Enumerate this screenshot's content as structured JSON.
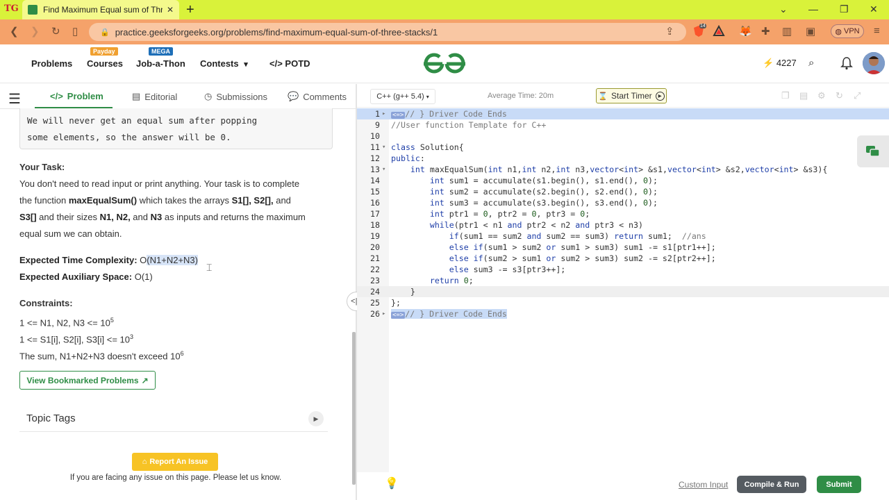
{
  "browser": {
    "tab_title": "Find Maximum Equal sum of Thre",
    "tab_close": "✕",
    "new_tab": "+",
    "url": "practice.geeksforgeeks.org/problems/find-maximum-equal-sum-of-three-stacks/1",
    "vpn_label": "VPN",
    "ext_badge": "14"
  },
  "header": {
    "nav": [
      "Problems",
      "Courses",
      "Job-a-Thon",
      "Contests",
      "POTD"
    ],
    "courses_badge": "Payday",
    "jobathon_badge": "MEGA",
    "streak": "4227",
    "colors": {
      "brand_green": "#2f8d46",
      "badge_orange": "#f0a030",
      "badge_blue": "#1e6fb8"
    }
  },
  "left_tabs": {
    "problem": "Problem",
    "editorial": "Editorial",
    "submissions": "Submissions",
    "comments": "Comments"
  },
  "problem": {
    "example_line1": "We will never get an equal sum after popping",
    "example_line2": "some elements, so the answer will be 0.",
    "task_heading": "Your Task:",
    "task_p1": "You don't need to read input or print anything. Your task is to complete",
    "task_p2_a": "the function ",
    "task_fn": "maxEqualSum()",
    "task_p2_b": " which takes the arrays ",
    "task_arr1": "S1[], S2[],",
    "task_p2_c": " and",
    "task_arr3": "S3[]",
    "task_p3_a": " and their sizes ",
    "task_sizes": "N1, N2,",
    "task_p3_b": " and ",
    "task_n3": "N3",
    "task_p3_c": " as inputs and returns the maximum",
    "task_p4": "equal sum we can obtain.",
    "etc_label": "Expected Time Complexity:",
    "etc_o": "O",
    "etc_val": "(N1+N2+N3)",
    "eas_label": "Expected Auxiliary Space:",
    "eas_val": "O(1)",
    "constraints_heading": "Constraints:",
    "c1": "1 <= N1, N2, N3 <= 10",
    "c1_exp": "5",
    "c2": "1 <= S1[i], S2[i], S3[i] <= 10",
    "c2_exp": "3",
    "c3": "The sum, N1+N2+N3 doesn't exceed 10",
    "c3_exp": "6",
    "bookmark_label": "View Bookmarked Problems",
    "topic_tags": "Topic Tags",
    "report_label": "Report An Issue",
    "report_note": "If you are facing any issue on this page. Please let us know."
  },
  "editor": {
    "language": "C++ (g++ 5.4)",
    "avg_time": "Average Time: 20m",
    "start_timer": "Start Timer",
    "custom_input": "Custom Input",
    "compile_run": "Compile & Run",
    "submit": "Submit",
    "lines": [
      {
        "n": "1",
        "fold": "▸",
        "text": "// } Driver Code Ends",
        "cls": "hlline",
        "type": "cm",
        "mark": true
      },
      {
        "n": "9",
        "fold": "",
        "text": "//User function Template for C++",
        "cls": "",
        "type": "cm"
      },
      {
        "n": "10",
        "fold": "",
        "text": "",
        "cls": "",
        "type": ""
      },
      {
        "n": "11",
        "fold": "▾",
        "text": "class Solution{",
        "cls": "",
        "type": "code"
      },
      {
        "n": "12",
        "fold": "",
        "text": "public:",
        "cls": "",
        "type": "code"
      },
      {
        "n": "13",
        "fold": "▾",
        "text": "    int maxEqualSum(int n1,int n2,int n3,vector<int> &s1,vector<int> &s2,vector<int> &s3){",
        "cls": "",
        "type": "code"
      },
      {
        "n": "14",
        "fold": "",
        "text": "        int sum1 = accumulate(s1.begin(), s1.end(), 0);",
        "cls": "",
        "type": "code"
      },
      {
        "n": "15",
        "fold": "",
        "text": "        int sum2 = accumulate(s2.begin(), s2.end(), 0);",
        "cls": "",
        "type": "code"
      },
      {
        "n": "16",
        "fold": "",
        "text": "        int sum3 = accumulate(s3.begin(), s3.end(), 0);",
        "cls": "",
        "type": "code"
      },
      {
        "n": "17",
        "fold": "",
        "text": "        int ptr1 = 0, ptr2 = 0, ptr3 = 0;",
        "cls": "",
        "type": "code"
      },
      {
        "n": "18",
        "fold": "",
        "text": "        while(ptr1 < n1 and ptr2 < n2 and ptr3 < n3)",
        "cls": "",
        "type": "code"
      },
      {
        "n": "19",
        "fold": "",
        "text": "            if(sum1 == sum2 and sum2 == sum3) return sum1;  //ans",
        "cls": "",
        "type": "code"
      },
      {
        "n": "20",
        "fold": "",
        "text": "            else if(sum1 > sum2 or sum1 > sum3) sum1 -= s1[ptr1++];",
        "cls": "",
        "type": "code"
      },
      {
        "n": "21",
        "fold": "",
        "text": "            else if(sum2 > sum1 or sum2 > sum3) sum2 -= s2[ptr2++];",
        "cls": "",
        "type": "code"
      },
      {
        "n": "22",
        "fold": "",
        "text": "            else sum3 -= s3[ptr3++];",
        "cls": "",
        "type": "code"
      },
      {
        "n": "23",
        "fold": "",
        "text": "        return 0;",
        "cls": "",
        "type": "code"
      },
      {
        "n": "24",
        "fold": "",
        "text": "    }",
        "cls": "curline",
        "type": "code"
      },
      {
        "n": "25",
        "fold": "",
        "text": "};",
        "cls": "",
        "type": "code"
      },
      {
        "n": "26",
        "fold": "▸",
        "text": "// } Driver Code Ends",
        "cls": "",
        "type": "cm",
        "mark": true,
        "selonly": true
      }
    ]
  }
}
